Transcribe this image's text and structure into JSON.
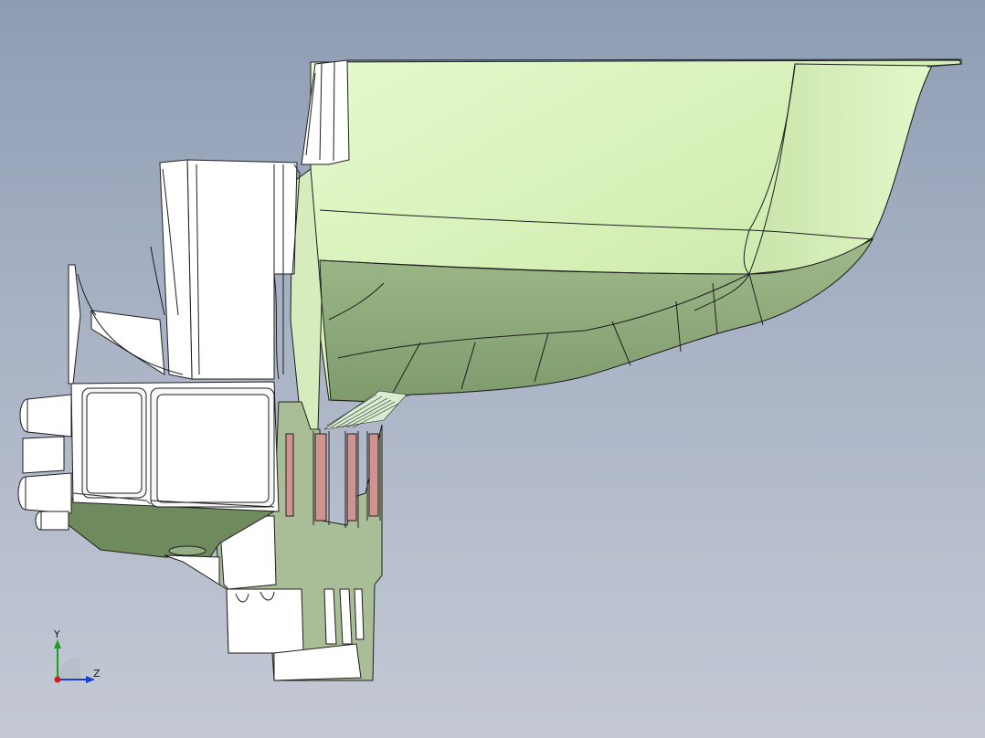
{
  "viewport": {
    "background_top": "#8e9cb3",
    "background_bottom": "#c4c9d4"
  },
  "model": {
    "body_color_light": "#e3f7c8",
    "body_color_shadow": "#8fa67c",
    "cross_section_color": "#a8bb97",
    "rib_color": "#ffffff",
    "section_highlight": "#c97a78",
    "edge_color": "#1e1e1e"
  },
  "triad": {
    "y_label": "Y",
    "z_label": "Z",
    "y_color": "#1aa01a",
    "z_color": "#1a3fd6",
    "x_color": "#d61a1a"
  }
}
